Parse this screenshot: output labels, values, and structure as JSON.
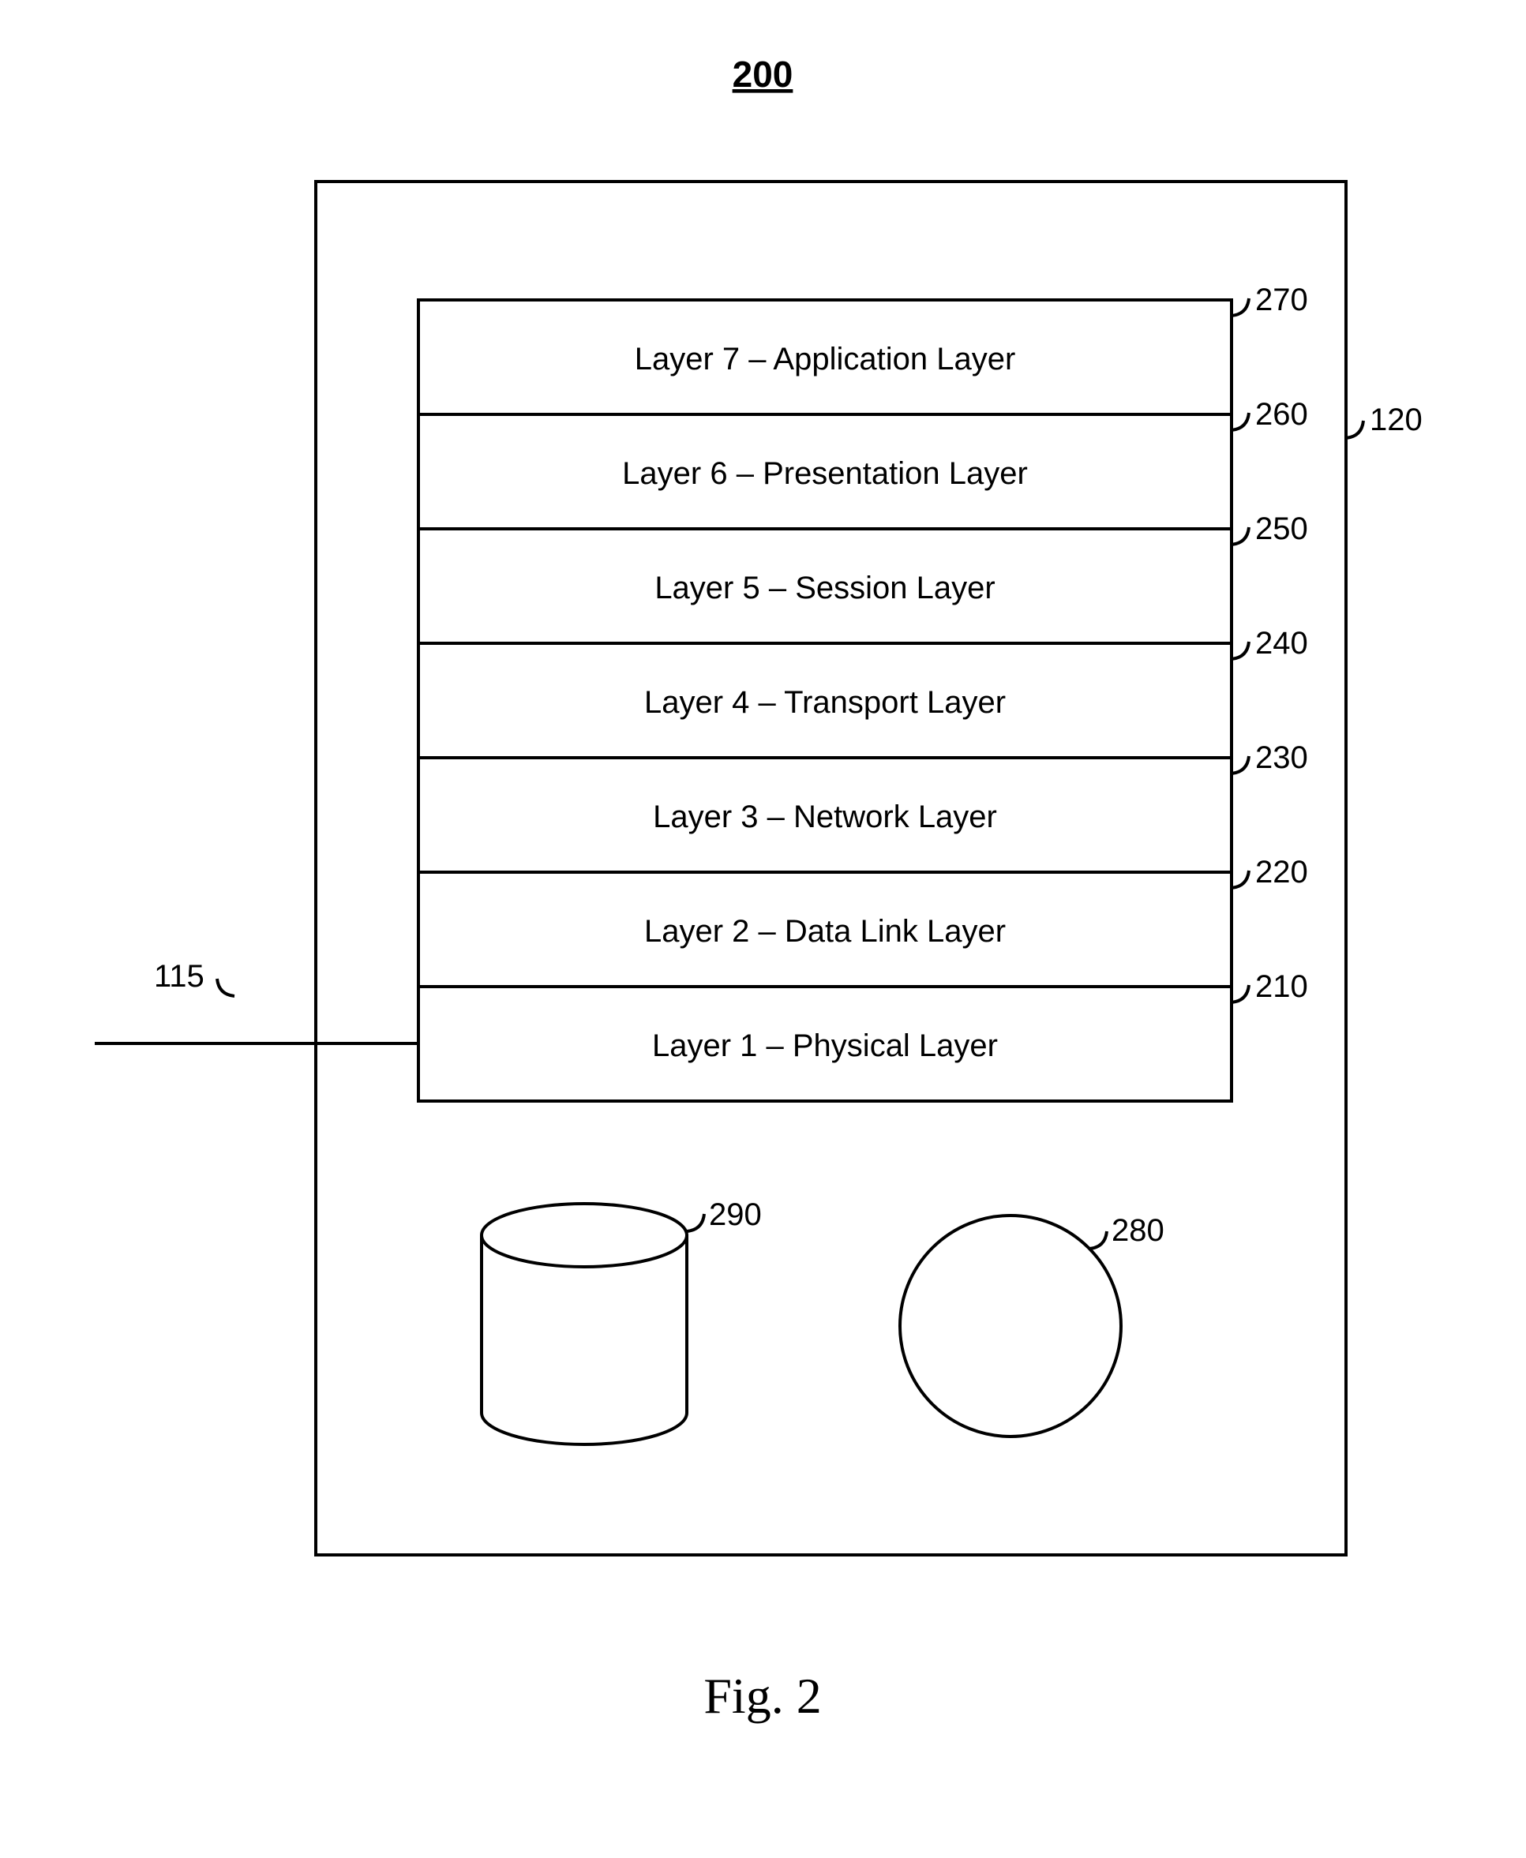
{
  "title_ref": "200",
  "figure_caption": "Fig. 2",
  "outer_ref": "120",
  "connector_ref": "115",
  "cylinder_ref": "290",
  "circle_ref": "280",
  "layers": [
    {
      "label": "Layer 7 – Application Layer",
      "ref": "270"
    },
    {
      "label": "Layer 6 – Presentation Layer",
      "ref": "260"
    },
    {
      "label": "Layer 5 – Session Layer",
      "ref": "250"
    },
    {
      "label": "Layer 4 – Transport Layer",
      "ref": "240"
    },
    {
      "label": "Layer 3 – Network Layer",
      "ref": "230"
    },
    {
      "label": "Layer 2 – Data Link Layer",
      "ref": "220"
    },
    {
      "label": "Layer 1 – Physical Layer",
      "ref": "210"
    }
  ]
}
